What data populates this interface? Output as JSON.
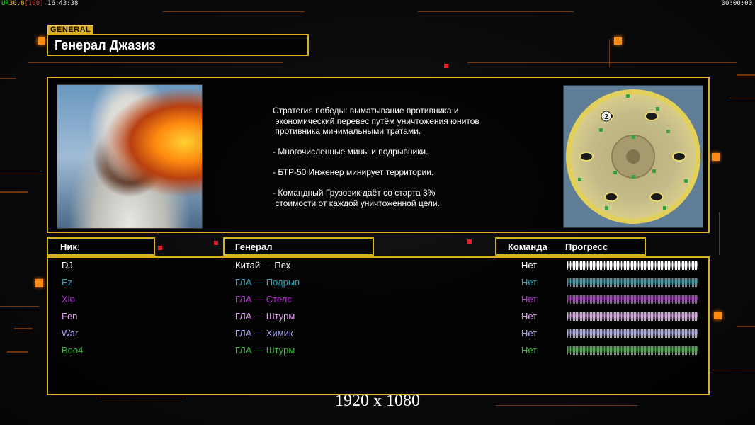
{
  "overlay": {
    "fps_prefix": "UR",
    "fps_value": "30.8",
    "fps_bracket": "[100]",
    "clock": "16:43:38",
    "timer": "00:00:00"
  },
  "general_card": {
    "tag": "GENERAL",
    "name": "Генерал Джазиз",
    "description": "Стратегия победы: выматывание противника и\n экономический перевес путём уничтожения юнитов\n противника минимальными тратами.\n\n- Многочисленные мины и подрывники.\n\n- БТР-50 Инженер минирует территории.\n\n- Командный Грузовик даёт со старта 3%\n стоимости от каждой уничтоженной цели.",
    "map_marker": "2"
  },
  "columns": {
    "nick": "Ник:",
    "general": "Генерал",
    "team": "Команда",
    "progress": "Прогресс"
  },
  "players": [
    {
      "nick": "DJ",
      "general": "Китай — Пех",
      "team": "Нет",
      "color": "#ffffff",
      "progress": 1.0
    },
    {
      "nick": "Ez",
      "general": "ГЛА — Подрыв",
      "team": "Нет",
      "color": "#2ea4b4",
      "progress": 1.0
    },
    {
      "nick": "Xio",
      "general": "ГЛА — Стелс",
      "team": "Нет",
      "color": "#b830d8",
      "progress": 1.0
    },
    {
      "nick": "Fen",
      "general": "ГЛА — Штурм",
      "team": "Нет",
      "color": "#e0a0f0",
      "progress": 1.0
    },
    {
      "nick": "War",
      "general": "ГЛА — Химик",
      "team": "Нет",
      "color": "#a8a8f4",
      "progress": 1.0
    },
    {
      "nick": "Boo4",
      "general": "ГЛА — Штурм",
      "team": "Нет",
      "color": "#3cb83c",
      "progress": 1.0
    }
  ],
  "resolution_label": "1920 x 1080",
  "colors": {
    "frame": "#d9b020",
    "accent": "#ff8a14"
  }
}
